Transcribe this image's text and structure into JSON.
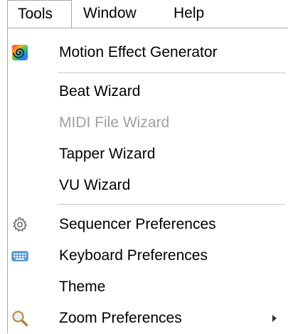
{
  "menubar": {
    "items": [
      {
        "label": "Tools",
        "active": true
      },
      {
        "label": "Window",
        "active": false
      },
      {
        "label": "Help",
        "active": false
      }
    ]
  },
  "tools_menu": {
    "motion_effect_generator": "Motion Effect Generator",
    "beat_wizard": "Beat Wizard",
    "midi_file_wizard": "MIDI File Wizard",
    "tapper_wizard": "Tapper Wizard",
    "vu_wizard": "VU Wizard",
    "sequencer_preferences": "Sequencer Preferences",
    "keyboard_preferences": "Keyboard Preferences",
    "theme": "Theme",
    "zoom_preferences": "Zoom Preferences"
  },
  "icons": {
    "motion_effect": "rainbow-spiral-icon",
    "sequencer_preferences": "gear-icon",
    "keyboard_preferences": "keyboard-icon",
    "zoom_preferences": "magnifier-icon",
    "submenu": "chevron-right-icon"
  },
  "colors": {
    "disabled_text": "#a0a0a0",
    "separator": "#c8c8c8",
    "menu_border": "#a8a8a8"
  }
}
